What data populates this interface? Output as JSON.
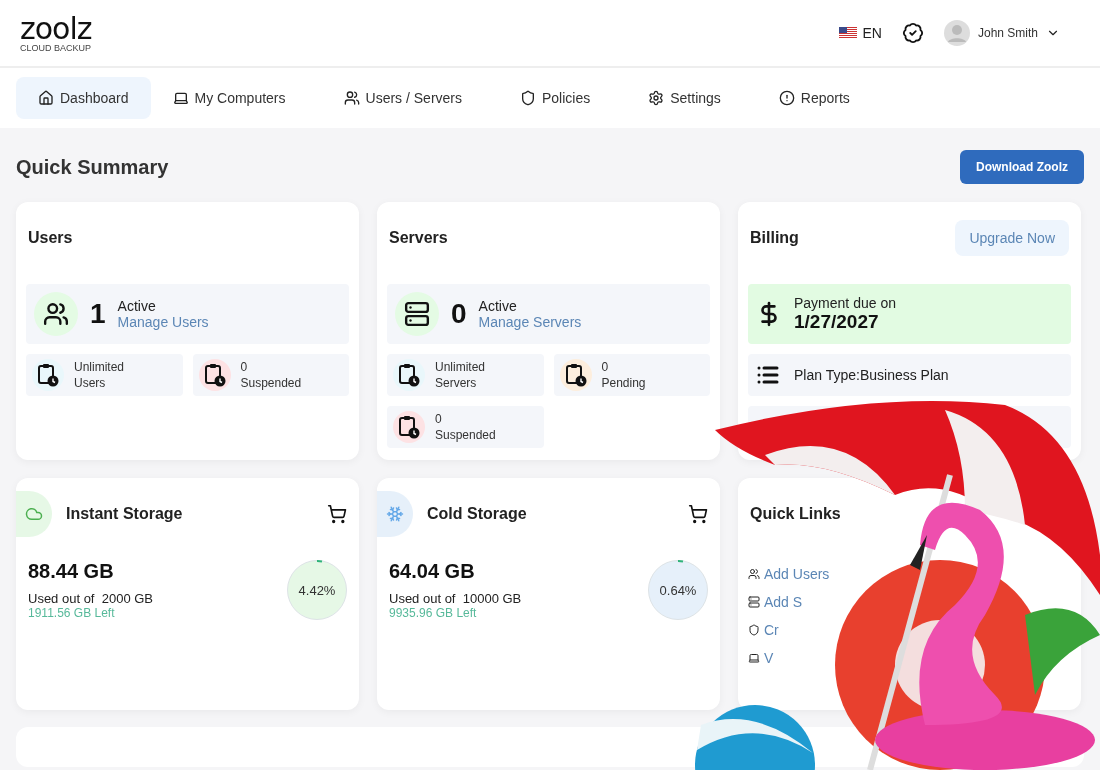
{
  "header": {
    "logo": "zoolz",
    "tagline": "CLOUD BACKUP",
    "language": "EN",
    "user": "John Smith"
  },
  "nav": [
    {
      "kind": "home",
      "label": "Dashboard",
      "selected": true
    },
    {
      "kind": "laptop",
      "label": "My Computers",
      "selected": false
    },
    {
      "kind": "users",
      "label": "Users / Servers",
      "selected": false
    },
    {
      "kind": "shield",
      "label": "Policies",
      "selected": false
    },
    {
      "kind": "gear",
      "label": "Settings",
      "selected": false
    },
    {
      "kind": "alert",
      "label": "Reports",
      "selected": false
    }
  ],
  "page_title": "Quick Summary",
  "download_button": "Download Zoolz",
  "summary": [
    {
      "kind": "users",
      "title": "Users",
      "count": "1",
      "status": "Active",
      "link": "Manage Users",
      "stats": [
        {
          "value": "Unlimited",
          "label": "Users",
          "color": "#e9f7fb"
        },
        {
          "value": "0",
          "label": "Suspended",
          "color": "#fde2e4"
        }
      ]
    },
    {
      "kind": "servers",
      "title": "Servers",
      "count": "0",
      "status": "Active",
      "link": "Manage Servers",
      "stats": [
        {
          "value": "Unlimited",
          "label": "Servers",
          "color": "#e9f7fb"
        },
        {
          "value": "0",
          "label": "Pending",
          "color": "#fdeedd"
        },
        {
          "value": "0",
          "label": "Suspended",
          "color": "#fde2e4"
        }
      ]
    }
  ],
  "billing": {
    "title": "Billing",
    "button": "Upgrade Now",
    "due_label": "Payment due on",
    "due_date": "1/27/2027",
    "plan": "Plan Type:Business Plan"
  },
  "storage": [
    {
      "kind": "cloud",
      "title": "Instant Storage",
      "amount": "88.44 GB",
      "used": "Used out of  2000 GB",
      "left": "1911.56 GB Left",
      "percent": "4.42%",
      "color": "#e6f8e6"
    },
    {
      "kind": "snow",
      "title": "Cold Storage",
      "amount": "64.04 GB",
      "used": "Used out of  10000 GB",
      "left": "9935.96 GB Left",
      "percent": "0.64%",
      "color": "#e6f0fa"
    }
  ],
  "quick_links": {
    "title": "Quick Links",
    "items": [
      {
        "kind": "users",
        "label": "Add Users"
      },
      {
        "kind": "server",
        "label": "Add S"
      },
      {
        "kind": "shield",
        "label": "Cr"
      },
      {
        "kind": "laptop",
        "label": "V"
      }
    ]
  }
}
